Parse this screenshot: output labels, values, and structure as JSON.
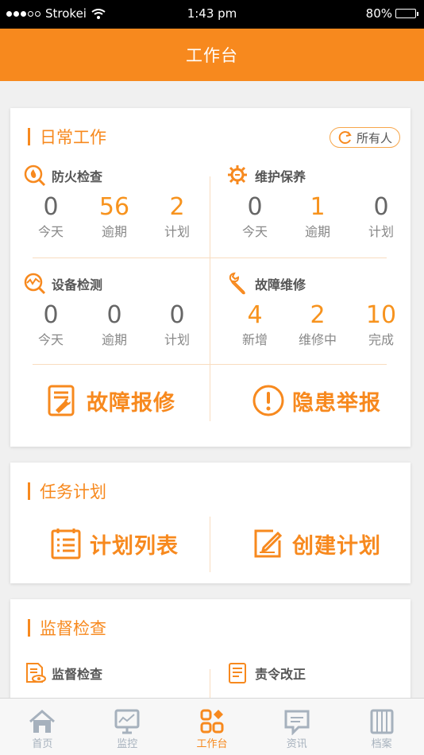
{
  "status_bar": {
    "carrier": "Strokei",
    "time": "1:43 pm",
    "battery": "80%",
    "battery_level": 0.8
  },
  "header": {
    "title": "工作台"
  },
  "daily": {
    "title": "日常工作",
    "owner_filter": "所有人",
    "fire": {
      "title": "防火检查",
      "stats": [
        {
          "value": "0",
          "label": "今天"
        },
        {
          "value": "56",
          "label": "逾期"
        },
        {
          "value": "2",
          "label": "计划"
        }
      ]
    },
    "maintain": {
      "title": "维护保养",
      "stats": [
        {
          "value": "0",
          "label": "今天"
        },
        {
          "value": "1",
          "label": "逾期"
        },
        {
          "value": "0",
          "label": "计划"
        }
      ]
    },
    "device": {
      "title": "设备检测",
      "stats": [
        {
          "value": "0",
          "label": "今天"
        },
        {
          "value": "0",
          "label": "逾期"
        },
        {
          "value": "0",
          "label": "计划"
        }
      ]
    },
    "repair": {
      "title": "故障维修",
      "stats": [
        {
          "value": "4",
          "label": "新增"
        },
        {
          "value": "2",
          "label": "维修中"
        },
        {
          "value": "10",
          "label": "完成"
        }
      ]
    },
    "report_fault": "故障报修",
    "report_hazard": "隐患举报"
  },
  "plan": {
    "title": "任务计划",
    "list": "计划列表",
    "create": "创建计划"
  },
  "supervise": {
    "title": "监督检查",
    "check": "监督检查",
    "rectify": "责令改正"
  },
  "tabs": [
    {
      "label": "首页",
      "icon": "home-icon"
    },
    {
      "label": "监控",
      "icon": "monitor-icon"
    },
    {
      "label": "工作台",
      "icon": "workbench-icon"
    },
    {
      "label": "资讯",
      "icon": "news-icon"
    },
    {
      "label": "档案",
      "icon": "archive-icon"
    }
  ],
  "colors": {
    "accent": "#f7891e",
    "tab_inactive": "#a6b1bd"
  }
}
